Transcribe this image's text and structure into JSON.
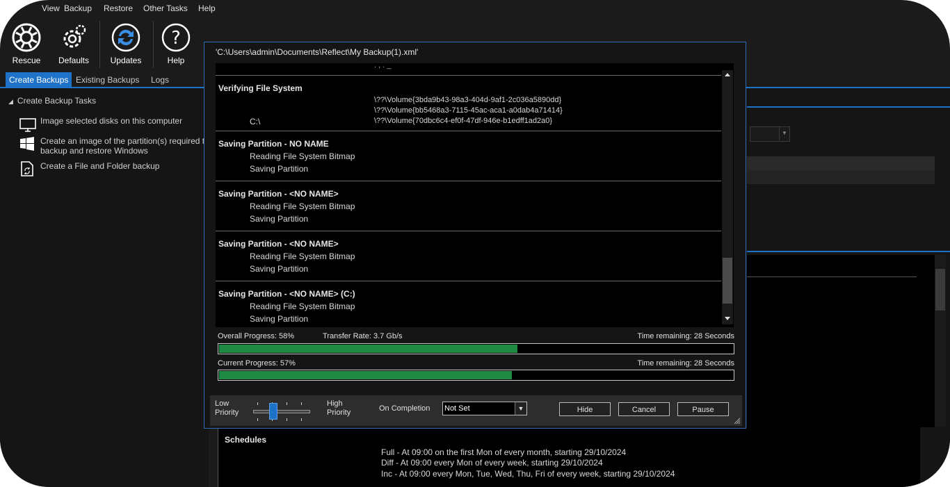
{
  "menu": [
    "View",
    "Backup",
    "Restore",
    "Other Tasks",
    "Help"
  ],
  "toolbar": {
    "rescue": "Rescue",
    "defaults": "Defaults",
    "updates": "Updates",
    "help": "Help"
  },
  "tabs": [
    "Create Backups",
    "Existing Backups",
    "Logs"
  ],
  "tree": {
    "header": "Create Backup Tasks",
    "items": [
      {
        "icon": "monitor-icon",
        "label": "Image selected disks on this computer"
      },
      {
        "icon": "windows-icon",
        "label": "Create an image of the partition(s) required to backup and restore Windows"
      },
      {
        "icon": "file-backup-icon",
        "label": "Create a File and Folder backup"
      }
    ]
  },
  "dialog": {
    "title": "'C:\\Users\\admin\\Documents\\Reflect\\My Backup(1).xml'",
    "log": [
      {
        "heading": "Verifying File System",
        "lines": [],
        "volumes": [
          "\\??\\Volume{3bda9b43-98a3-404d-9af1-2c036a5890dd}",
          "\\??\\Volume{bb5468a3-7115-45ac-aca1-a0dab4a71414}",
          "\\??\\Volume{70dbc6c4-ef0f-47df-946e-b1edff1ad2a0}"
        ],
        "drive": "C:\\"
      },
      {
        "heading": "Saving Partition - NO NAME",
        "lines": [
          "Reading File System Bitmap",
          "Saving Partition"
        ]
      },
      {
        "heading": "Saving Partition - <NO NAME>",
        "lines": [
          "Reading File System Bitmap",
          "Saving Partition"
        ]
      },
      {
        "heading": "Saving Partition - <NO NAME>",
        "lines": [
          "Reading File System Bitmap",
          "Saving Partition"
        ]
      },
      {
        "heading": "Saving Partition - <NO NAME> (C:)",
        "lines": [
          "Reading File System Bitmap",
          "Saving Partition"
        ]
      }
    ],
    "overall": {
      "label": "Overall Progress:  58%",
      "rate": "Transfer Rate: 3.7 Gb/s",
      "remaining": "Time remaining: 28 Seconds",
      "fraction": 0.58
    },
    "current": {
      "label": "Current Progress:  57%",
      "remaining": "Time remaining: 28 Seconds",
      "fraction": 0.57
    },
    "priority": {
      "low": [
        "Low",
        "Priority"
      ],
      "high": [
        "High",
        "Priority"
      ]
    },
    "completion_label": "On Completion",
    "completion_value": "Not Set",
    "hide_label": "Hide",
    "cancel_label": "Cancel",
    "pause_label": "Pause"
  },
  "schedules": {
    "heading": "Schedules",
    "lines": [
      "Full - At 09:00 on the first Mon of every month, starting 29/10/2024",
      "Diff - At 09:00 every Mon of every week, starting 29/10/2024",
      "Inc - At 09:00 every Mon, Tue, Wed, Thu, Fri of every week, starting 29/10/2024"
    ]
  },
  "colors": {
    "accent": "#1e73c9",
    "progress": "#1e8a44",
    "background": "#1b1b1b"
  }
}
